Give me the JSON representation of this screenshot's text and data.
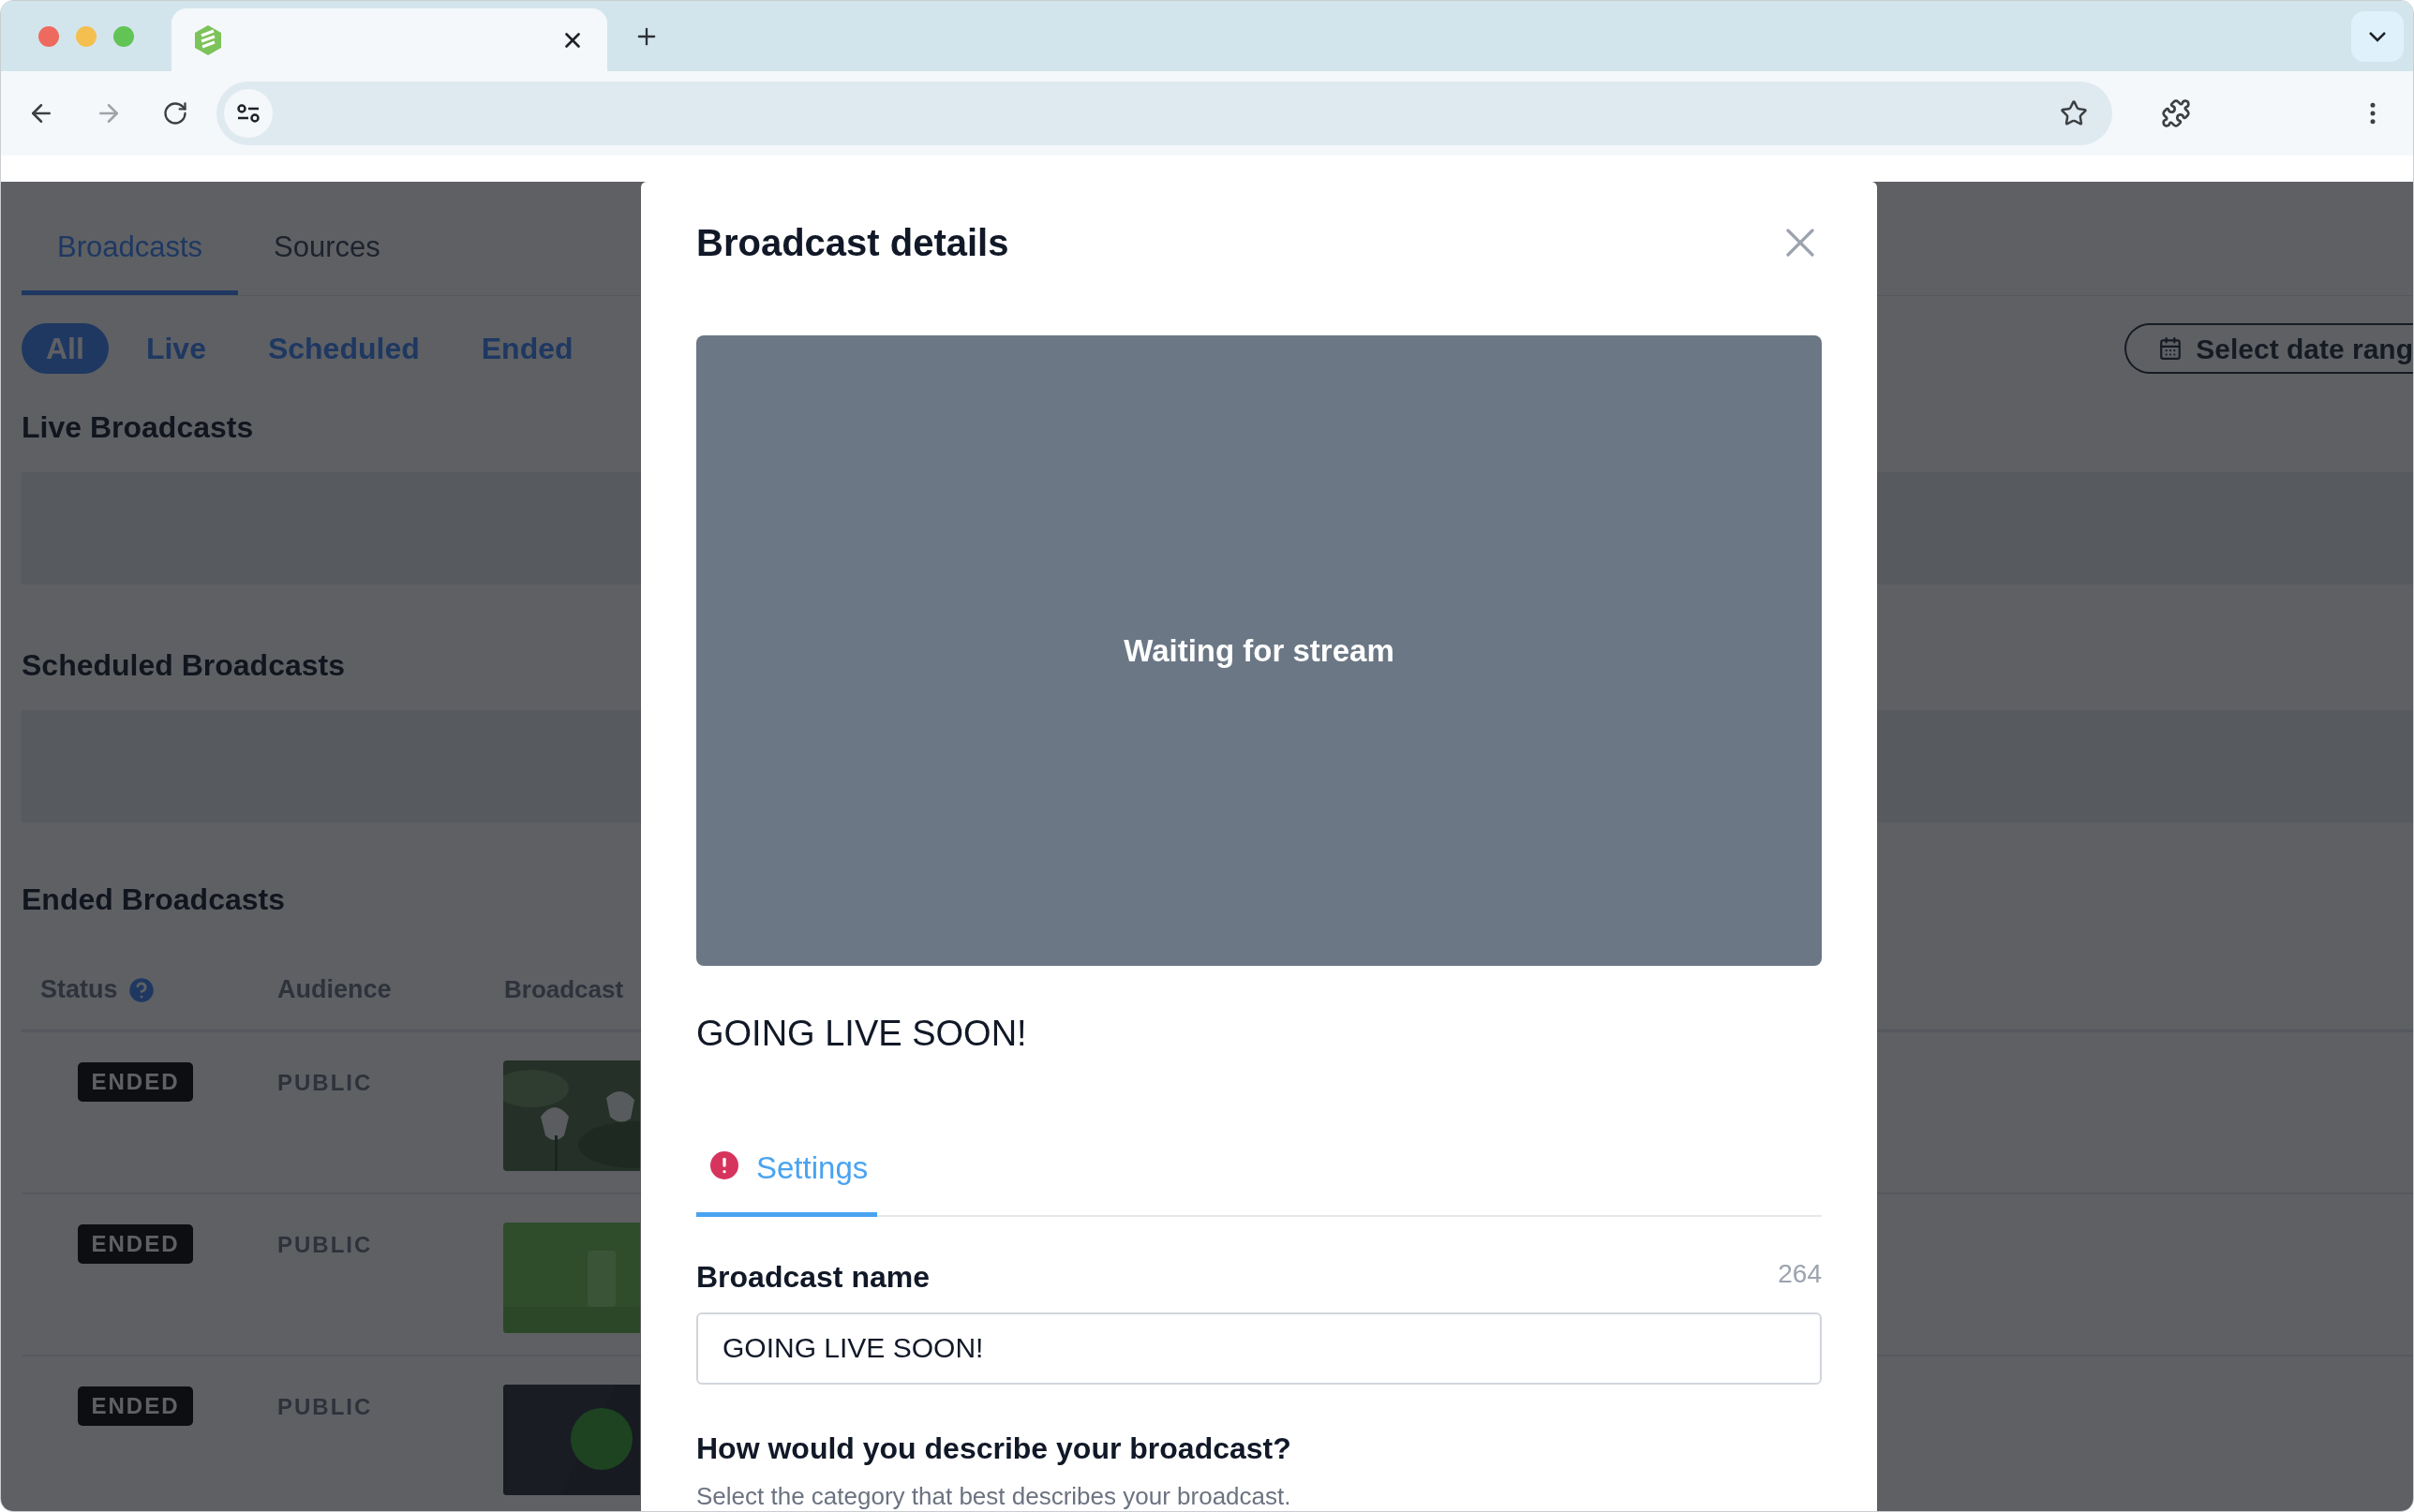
{
  "page": {
    "tabs": [
      {
        "label": "Broadcasts",
        "selected": true
      },
      {
        "label": "Sources",
        "selected": false
      }
    ],
    "filters": [
      {
        "label": "All",
        "selected": true
      },
      {
        "label": "Live",
        "selected": false
      },
      {
        "label": "Scheduled",
        "selected": false
      },
      {
        "label": "Ended",
        "selected": false
      }
    ],
    "date_button": {
      "label": "Select date rang"
    },
    "sections": [
      {
        "title": "Live Broadcasts"
      },
      {
        "title": "Scheduled Broadcasts"
      }
    ],
    "ended": {
      "title": "Ended Broadcasts",
      "columns": [
        "Status",
        "Audience",
        "Broadcast"
      ],
      "rows": [
        {
          "status": "ENDED",
          "audience": "PUBLIC"
        },
        {
          "status": "ENDED",
          "audience": "PUBLIC"
        },
        {
          "status": "ENDED",
          "audience": "PUBLIC"
        }
      ]
    }
  },
  "modal": {
    "title": "Broadcast details",
    "preview_message": "Waiting for stream",
    "broadcast_title": "GOING LIVE SOON!",
    "tabs": [
      {
        "label": "Settings",
        "selected": true,
        "error": true
      }
    ],
    "name_field": {
      "label": "Broadcast name",
      "counter": "264",
      "value": "GOING LIVE SOON!"
    },
    "question": {
      "title": "How would you describe your broadcast?",
      "hint": "Select the category that best describes your broadcast."
    }
  }
}
